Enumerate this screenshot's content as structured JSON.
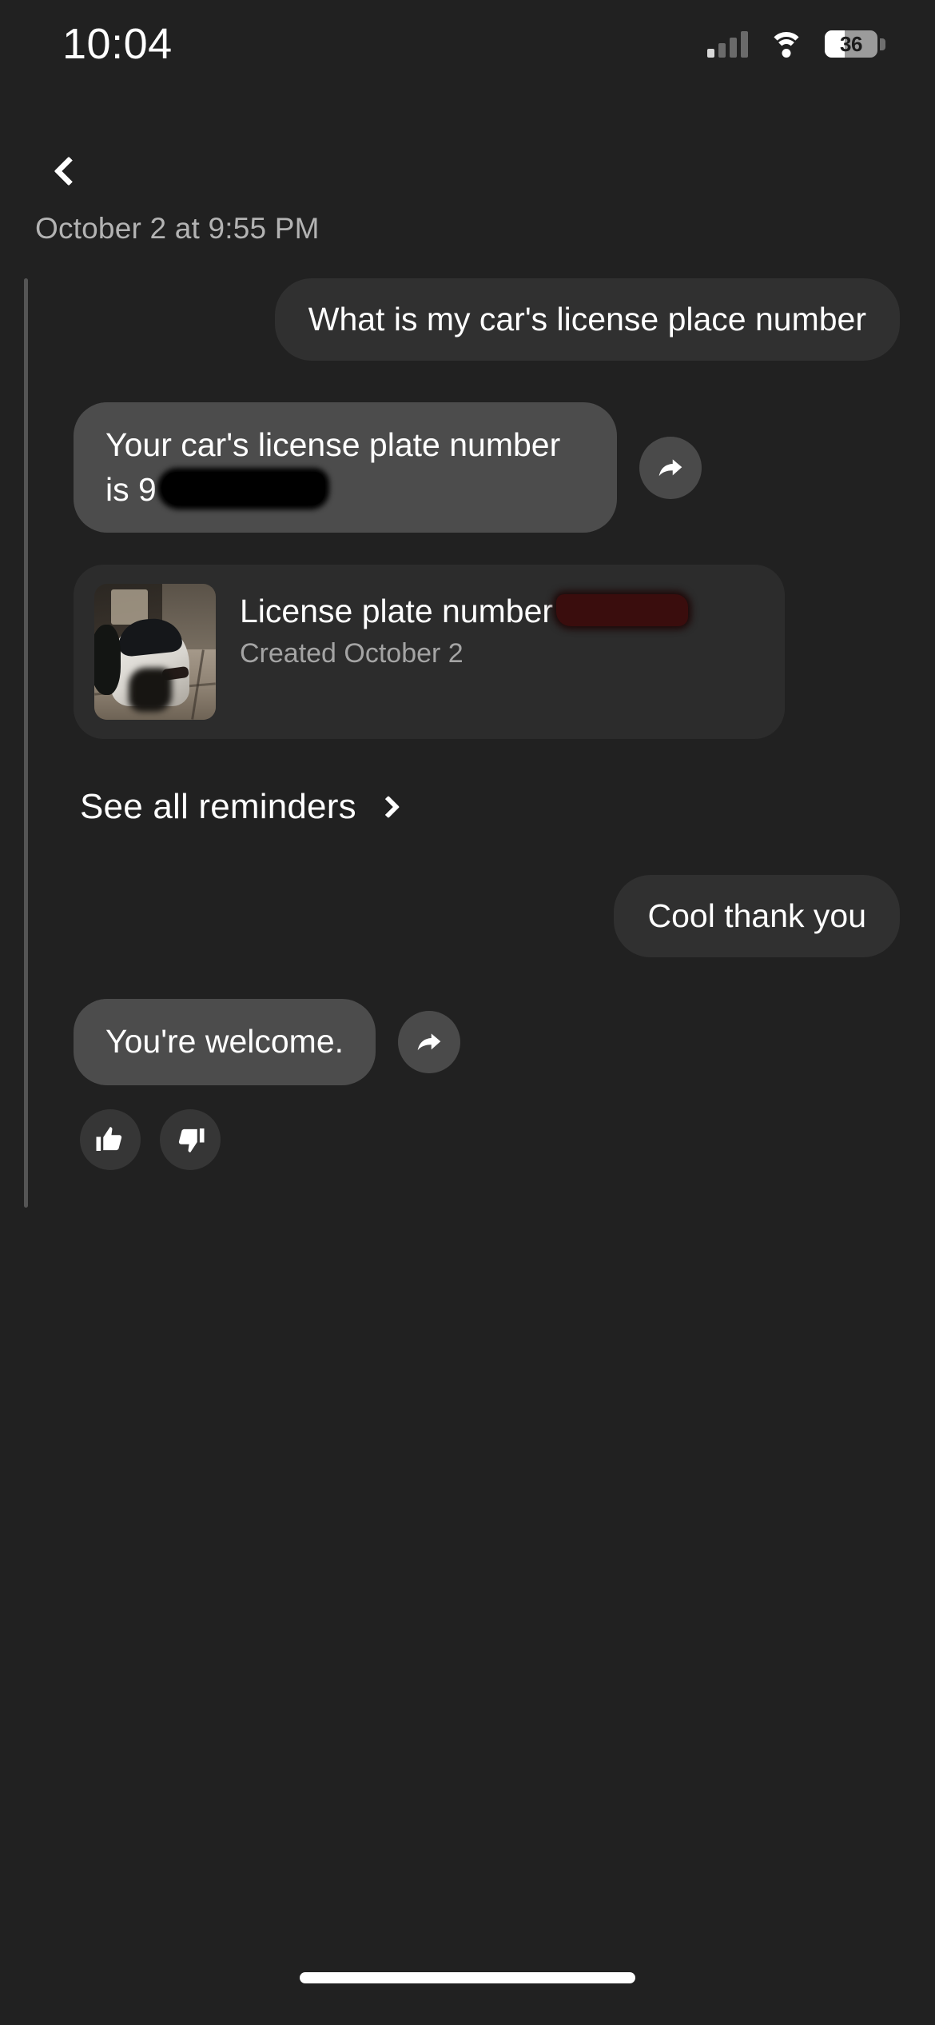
{
  "status_bar": {
    "time": "10:04",
    "battery_level": "36",
    "signal_icon": "cellular-signal-icon",
    "wifi_icon": "wifi-icon",
    "battery_icon": "battery-icon"
  },
  "nav": {
    "back_icon": "chevron-left-icon"
  },
  "conversation": {
    "date_header": "October 2 at 9:55 PM",
    "messages": [
      {
        "role": "user",
        "text": "What is my car's license place number"
      },
      {
        "role": "assistant",
        "text_before": "Your car's license plate number is 9",
        "text_redacted": true,
        "share_icon": "share-arrow-icon"
      }
    ],
    "reminder_card": {
      "thumbnail_icon": "car-photo-thumbnail",
      "title": "License plate number",
      "title_redacted": true,
      "subtitle": "Created October 2"
    },
    "see_all": {
      "label": "See all reminders",
      "chevron_icon": "chevron-right-icon"
    },
    "followup": [
      {
        "role": "user",
        "text": "Cool thank you"
      },
      {
        "role": "assistant",
        "text": "You're welcome.",
        "share_icon": "share-arrow-icon"
      }
    ],
    "feedback": {
      "thumbs_up_icon": "thumbs-up-icon",
      "thumbs_down_icon": "thumbs-down-icon"
    }
  },
  "colors": {
    "background": "#212121",
    "user_bubble": "#303030",
    "assistant_bubble": "#4c4c4c",
    "card": "#2c2c2c",
    "accent_text": "#ffffff",
    "muted_text": "#b3b3b3"
  }
}
